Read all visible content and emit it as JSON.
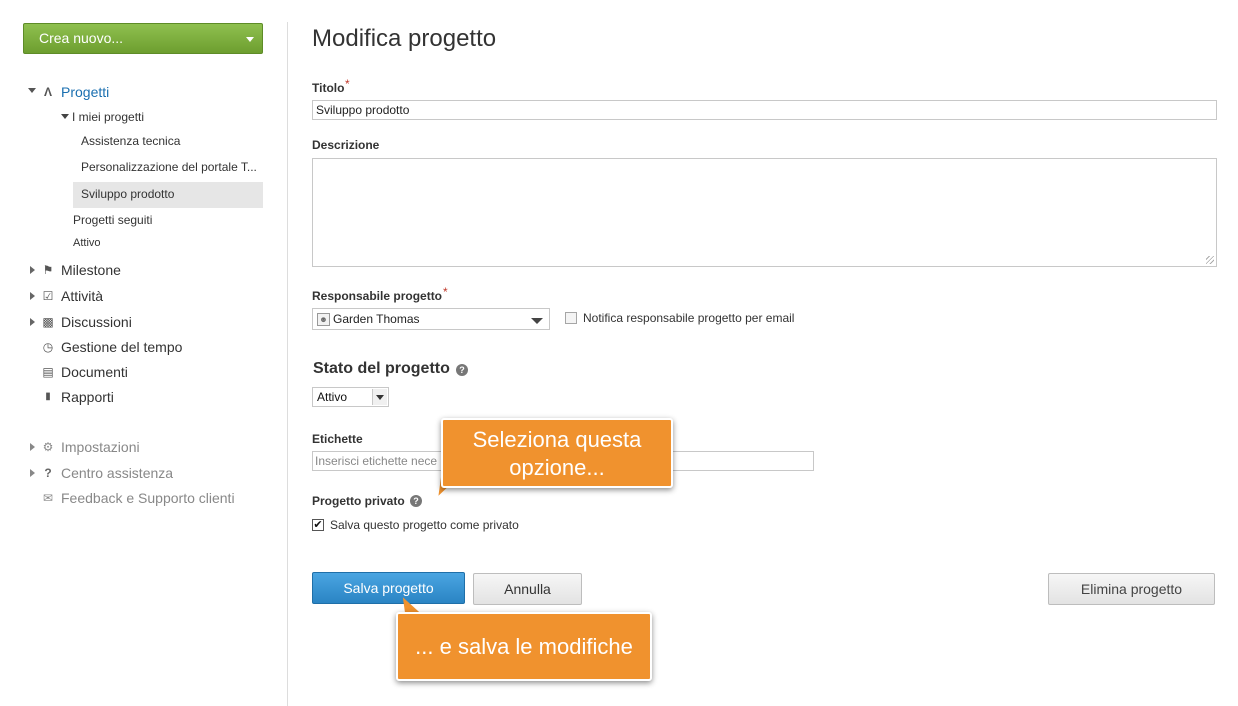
{
  "sidebar": {
    "create_label": "Crea nuovo...",
    "projects_label": "Progetti",
    "my_projects_label": "I miei progetti",
    "projects": [
      "Assistenza tecnica",
      "Personalizzazione del portale T...",
      "Sviluppo prodotto"
    ],
    "followed_label": "Progetti seguiti",
    "active_label": "Attivo",
    "items": [
      "Milestone",
      "Attività",
      "Discussioni",
      "Gestione del tempo",
      "Documenti",
      "Rapporti"
    ],
    "secondary": [
      "Impostazioni",
      "Centro assistenza",
      "Feedback e Supporto clienti"
    ]
  },
  "form": {
    "page_title": "Modifica progetto",
    "title_label": "Titolo",
    "required_mark": "*",
    "title_value": "Sviluppo prodotto",
    "description_label": "Descrizione",
    "description_value": "",
    "owner_label": "Responsabile progetto",
    "owner_value": "Garden Thomas",
    "notify_label": "Notifica responsabile progetto per email",
    "status_heading": "Stato del progetto",
    "status_value": "Attivo",
    "tags_label": "Etichette",
    "tags_placeholder": "Inserisci etichette nece",
    "private_label": "Progetto privato",
    "private_checkbox_label": "Salva questo progetto come privato",
    "private_checked": true,
    "save_label": "Salva progetto",
    "cancel_label": "Annulla",
    "delete_label": "Elimina progetto"
  },
  "callouts": {
    "first": "Seleziona questa opzione...",
    "second": "... e salva le modifiche"
  },
  "colors": {
    "create_button": "#7bb03d",
    "save_button": "#3594d4",
    "callout": "#f0922e",
    "selected_row": "#e6e6e6"
  }
}
